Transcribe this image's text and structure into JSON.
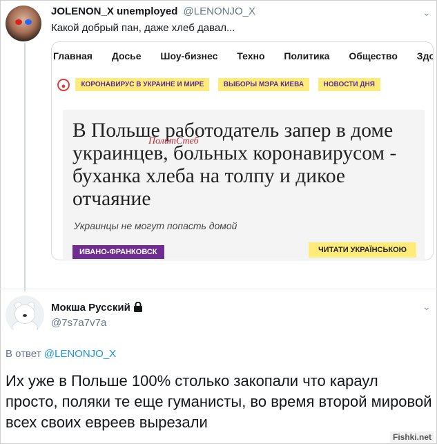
{
  "tweet1": {
    "name": "JOLENON_X unemployed",
    "handle": "@LENONJO_X",
    "text": "Какой добрый пан, даже хлеб давал..."
  },
  "card": {
    "nav": [
      "Главная",
      "Досье",
      "Шоу-бизнес",
      "Техно",
      "Политика",
      "Общество",
      "Здоровье"
    ],
    "tags": [
      "КОРОНАВИРУС В УКРАИНЕ И МИРЕ",
      "ВЫБОРЫ МЭРА КИЕВА",
      "НОВОСТИ ДНЯ"
    ],
    "headline": "В Польше работодатель запер в доме украинцев, больных коронавирусом - буханка хлеба на толпу и дикое отчаяние",
    "watermark": "ПолитСтеб",
    "subtitle": "Украинцы не могут попасть домой",
    "region": "ИВАНО-ФРАНКОВСК",
    "translate_button": "ЧИТАТИ УКРАЇНСЬКОЮ"
  },
  "tweet2": {
    "name": "Мокша Русский",
    "handle": "@7s7a7v7a",
    "reply_prefix": "В ответ",
    "reply_mention": "@LENONJO_X",
    "text": "Их уже в Польше 100% столько закопали что караул просто, поляки те еще гуманисты, во время второй мировой всех своих евреев вырезали"
  },
  "site_mark": "Fishki.net",
  "icons": {
    "menu": "chevron-down-icon",
    "lock": "lock-icon",
    "hot": "fire-icon"
  },
  "colors": {
    "tag_bg": "#ffeb7a",
    "tag_text": "#5b2d8a",
    "region_bg": "#6f2d91",
    "mention": "#1b95e0",
    "handle": "#657786"
  }
}
